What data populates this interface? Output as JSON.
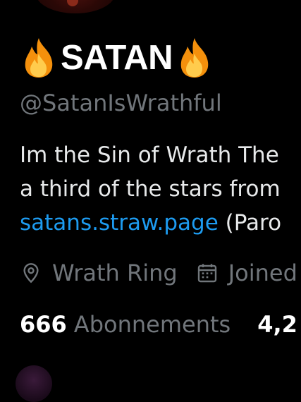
{
  "profile": {
    "name": "SATAN",
    "name_emoji": "fire-emoji",
    "handle": "@SatanIsWrathful",
    "bio": {
      "line1": "Im the Sin of Wrath  The",
      "line2": "a third of the stars from",
      "link": "satans.straw.page",
      "after_link": " (Paro"
    },
    "location": "Wrath Ring",
    "joined": "Joined",
    "stats": {
      "following_count": "666",
      "following_label": "Abonnements",
      "followers_count": "4,2"
    }
  },
  "colors": {
    "background": "#000000",
    "primary_text": "#e7e9ea",
    "secondary_text": "#71767b",
    "link": "#1d9bf0",
    "name": "#ffffff"
  },
  "icons": {
    "location": "location-pin-icon",
    "calendar": "calendar-icon"
  }
}
